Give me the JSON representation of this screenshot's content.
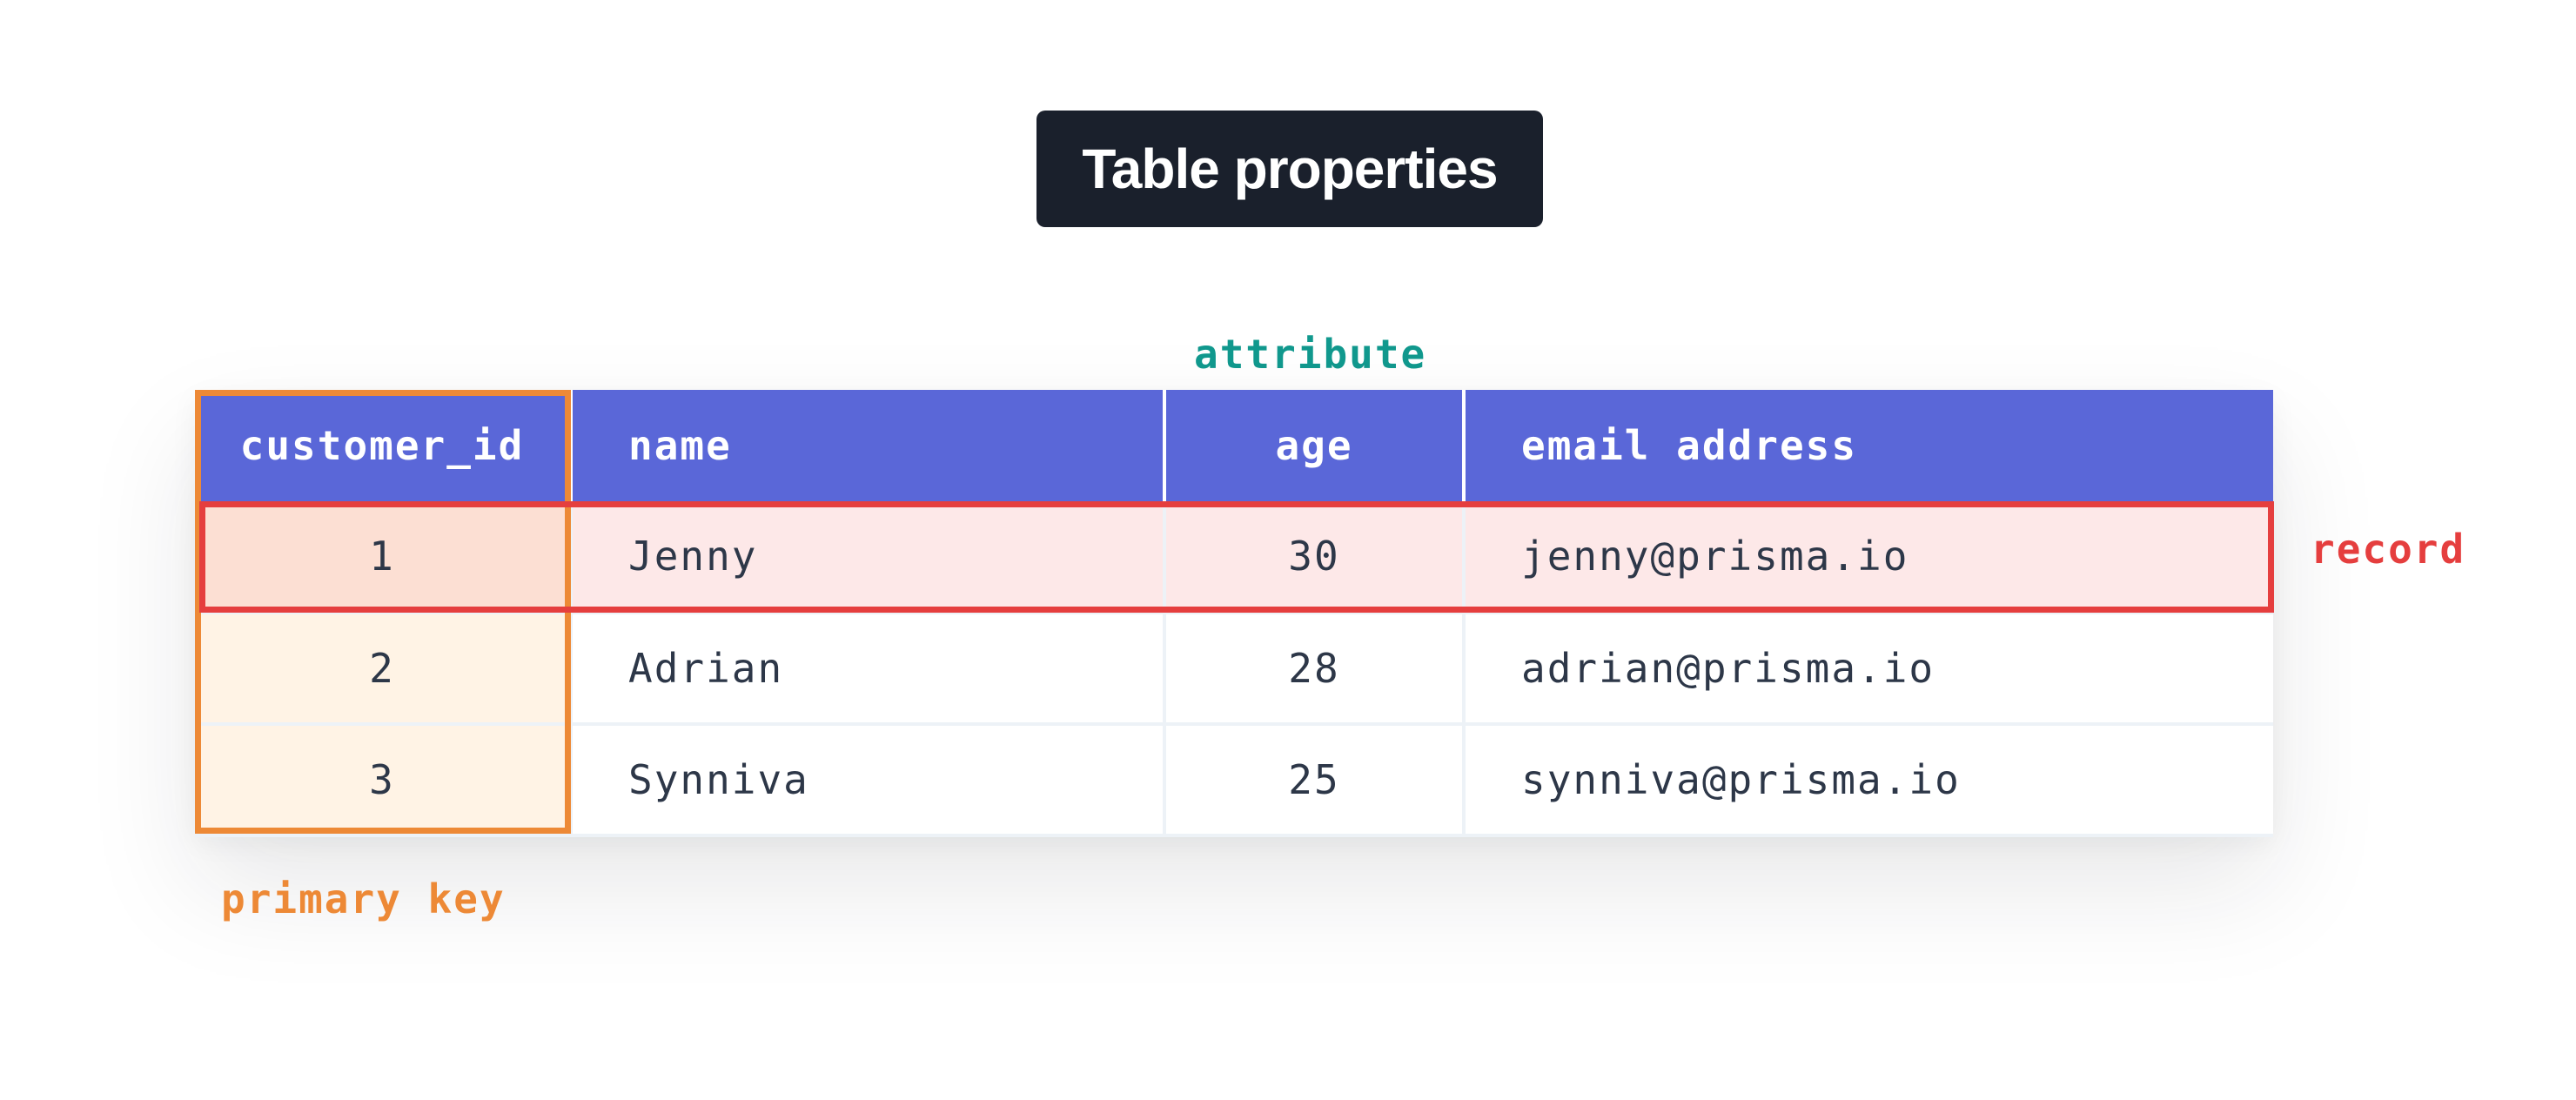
{
  "title": "Table properties",
  "labels": {
    "attribute": "attribute",
    "record": "record",
    "primary_key": "primary key"
  },
  "table": {
    "columns": [
      "customer_id",
      "name",
      "age",
      "email address"
    ],
    "rows": [
      [
        "1",
        "Jenny",
        "30",
        "jenny@prisma.io"
      ],
      [
        "2",
        "Adrian",
        "28",
        "adrian@prisma.io"
      ],
      [
        "3",
        "Synniva",
        "25",
        "synniva@prisma.io"
      ]
    ]
  },
  "colors": {
    "title_bg": "#1a202c",
    "header_bg": "#5a67d8",
    "primary_key": "#ed8936",
    "record": "#e53e3e",
    "attribute": "#11998e"
  }
}
